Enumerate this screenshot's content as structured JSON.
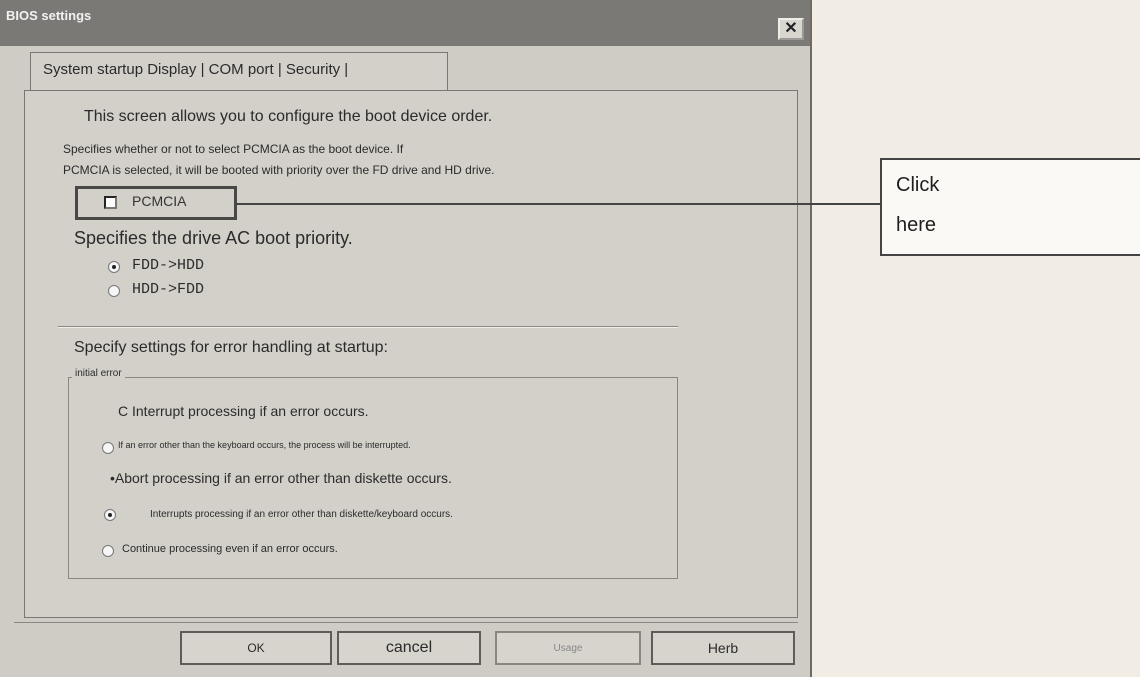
{
  "window": {
    "title": "BIOS settings",
    "close_glyph": "✕"
  },
  "tabs": [
    {
      "label": "System startup"
    },
    {
      "label": "Display"
    },
    {
      "label": "COM port"
    },
    {
      "label": "Security"
    }
  ],
  "tab_separator": "|",
  "boot": {
    "intro": "This screen allows you to configure the boot device order.",
    "pcmcia_desc_line1": "Specifies whether or not to select PCMCIA as the boot device. If",
    "pcmcia_desc_line2": "PCMCIA is selected, it will be booted with priority over the FD drive and HD drive.",
    "pcmcia_label": "PCMCIA",
    "pcmcia_checked": false,
    "priority_heading": "Specifies the drive AC boot priority.",
    "priority_options": [
      {
        "label": "FDD->HDD",
        "selected": true
      },
      {
        "label": "HDD->FDD",
        "selected": false
      }
    ]
  },
  "error_handling": {
    "heading": "Specify settings for error handling at startup:",
    "group_label": "initial error",
    "options": [
      "C Interrupt processing if an error occurs.",
      "If an error other than the keyboard occurs, the process will be interrupted.",
      "•Abort processing if an error other than diskette occurs.",
      "Interrupts processing if an error other than diskette/keyboard occurs.",
      "Continue processing even if an error occurs."
    ],
    "selected_index": 3
  },
  "buttons": {
    "ok": "OK",
    "cancel": "cancel",
    "usage": "Usage",
    "help": "Herb"
  },
  "callout": {
    "line1": "Click",
    "line2": "here"
  },
  "colors": {
    "titlebar": "#7b7975",
    "dialog_bg": "#cfccc6"
  }
}
